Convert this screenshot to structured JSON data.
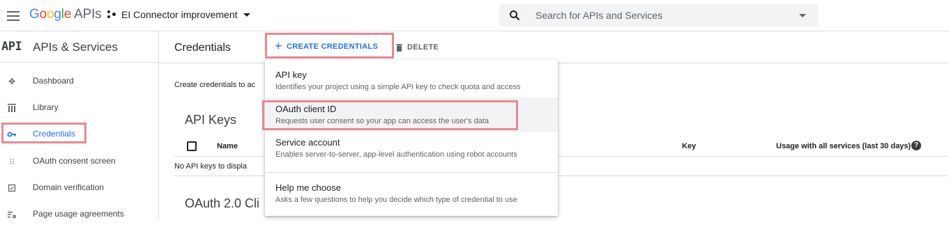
{
  "topbar": {
    "logo_google": "Google",
    "logo_apis": "APIs",
    "project_name": "EI Connector improvement",
    "search_placeholder": "Search for APIs and Services"
  },
  "sidebar": {
    "badge": "API",
    "title": "APIs & Services",
    "items": [
      {
        "label": "Dashboard",
        "icon": "dashboard-icon",
        "active": false
      },
      {
        "label": "Library",
        "icon": "library-icon",
        "active": false
      },
      {
        "label": "Credentials",
        "icon": "key-icon",
        "active": true
      },
      {
        "label": "OAuth consent screen",
        "icon": "consent-icon",
        "active": false
      },
      {
        "label": "Domain verification",
        "icon": "checkbox-icon",
        "active": false
      },
      {
        "label": "Page usage agreements",
        "icon": "settings-list-icon",
        "active": false
      }
    ]
  },
  "main": {
    "page_title": "Credentials",
    "create_label": "CREATE CREDENTIALS",
    "delete_label": "DELETE",
    "intro_text": "Create credentials to ac",
    "api_keys_title": "API Keys",
    "table": {
      "col_name": "Name",
      "col_key": "Key",
      "col_usage": "Usage with all services (last 30 days)",
      "empty_text": "No API keys to displa"
    },
    "oauth_title": "OAuth 2.0 Cli"
  },
  "menu": {
    "items": [
      {
        "title": "API key",
        "desc": "Identifies your project using a simple API key to check quota and access"
      },
      {
        "title": "OAuth client ID",
        "desc": "Requests user consent so your app can access the user's data"
      },
      {
        "title": "Service account",
        "desc": "Enables server-to-server, app-level authentication using robot accounts"
      },
      {
        "title": "Help me choose",
        "desc": "Asks a few questions to help you decide which type of credential to use"
      }
    ]
  },
  "colors": {
    "accent": "#1a73e8",
    "highlight": "#e98891",
    "text": "#202124",
    "muted": "#5f6368"
  }
}
